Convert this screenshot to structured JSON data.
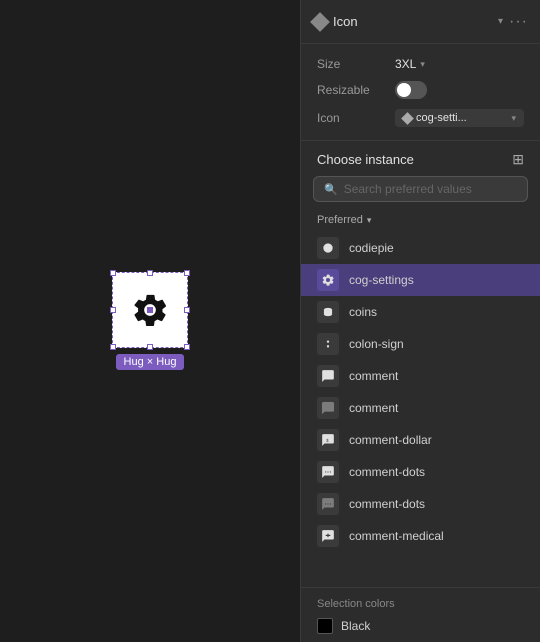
{
  "canvas": {
    "frame_label": "Hug × Hug"
  },
  "panel": {
    "header": {
      "title": "Icon",
      "more_label": "···"
    },
    "properties": {
      "size_label": "Size",
      "size_value": "3XL",
      "resizable_label": "Resizable",
      "icon_label": "Icon",
      "icon_value": "cog-setti..."
    },
    "choose_instance": {
      "title": "Choose instance",
      "search_placeholder": "Search preferred values"
    },
    "preferred_section": {
      "label": "Preferred"
    },
    "items": [
      {
        "name": "codiepie",
        "selected": false
      },
      {
        "name": "cog-settings",
        "selected": true
      },
      {
        "name": "coins",
        "selected": false
      },
      {
        "name": "colon-sign",
        "selected": false
      },
      {
        "name": "comment",
        "selected": false
      },
      {
        "name": "comment",
        "selected": false
      },
      {
        "name": "comment-dollar",
        "selected": false
      },
      {
        "name": "comment-dots",
        "selected": false
      },
      {
        "name": "comment-dots",
        "selected": false
      },
      {
        "name": "comment-medical",
        "selected": false
      }
    ],
    "selection_colors": {
      "label": "Selection colors",
      "colors": [
        {
          "name": "Black",
          "hex": "#000000"
        }
      ]
    }
  }
}
